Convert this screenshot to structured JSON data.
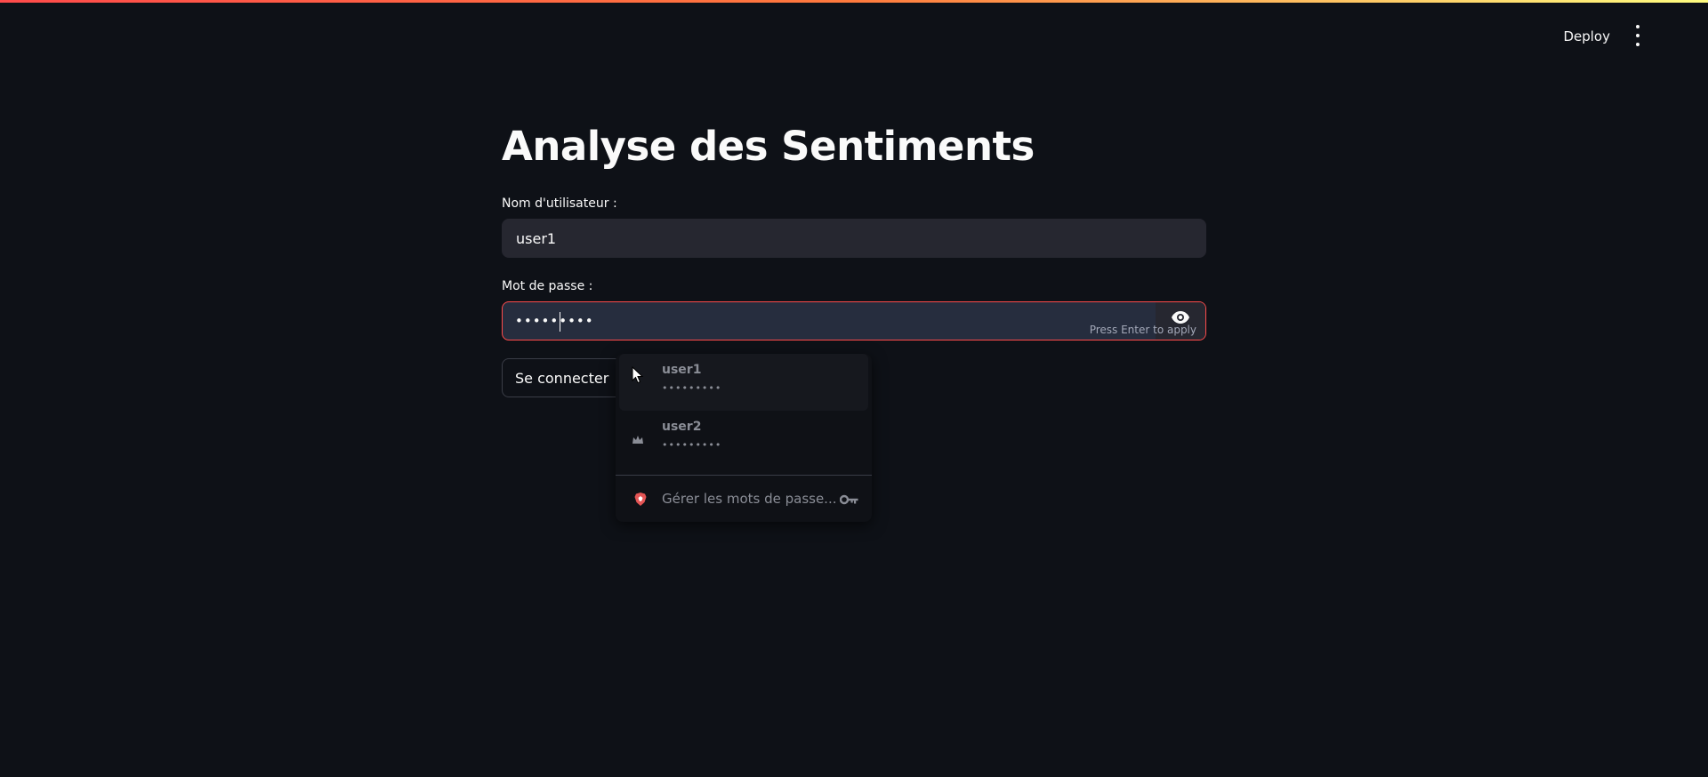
{
  "header": {
    "deploy_label": "Deploy",
    "menu_icon": "kebab-menu-icon"
  },
  "main": {
    "title": "Analyse des Sentiments",
    "username": {
      "label": "Nom d'utilisateur :",
      "value": "user1"
    },
    "password": {
      "label": "Mot de passe :",
      "value": "•••••••••",
      "hint": "Press Enter to apply",
      "toggle_icon": "eye-icon"
    },
    "login_button": "Se connecter"
  },
  "password_dropdown": {
    "items": [
      {
        "user": "user1",
        "masked": "•••••••••"
      },
      {
        "user": "user2",
        "masked": "•••••••••"
      }
    ],
    "manage_label": "Gérer les mots de passe...",
    "manage_icon": "key-icon",
    "brand_icon": "brave-lion-icon"
  },
  "colors": {
    "background": "#0e1117",
    "accent": "#ff4b4b",
    "input_bg": "#262730"
  }
}
